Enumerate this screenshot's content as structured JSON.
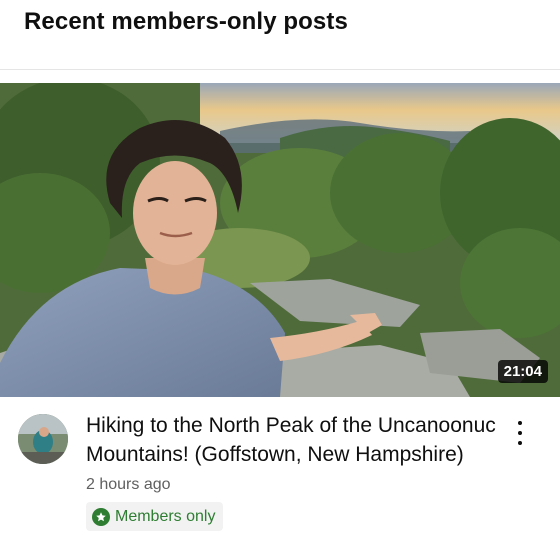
{
  "section": {
    "title": "Recent members-only posts"
  },
  "video": {
    "title": "Hiking to the North Peak of the Uncanoonuc Mountains! (Goffstown, New Hampshire)",
    "duration": "21:04",
    "age": "2 hours ago",
    "badge": {
      "label": "Members only",
      "icon": "star-icon",
      "color": "#2e7d32"
    }
  },
  "icons": {
    "more": "more-vert-icon",
    "avatar": "channel-avatar"
  }
}
